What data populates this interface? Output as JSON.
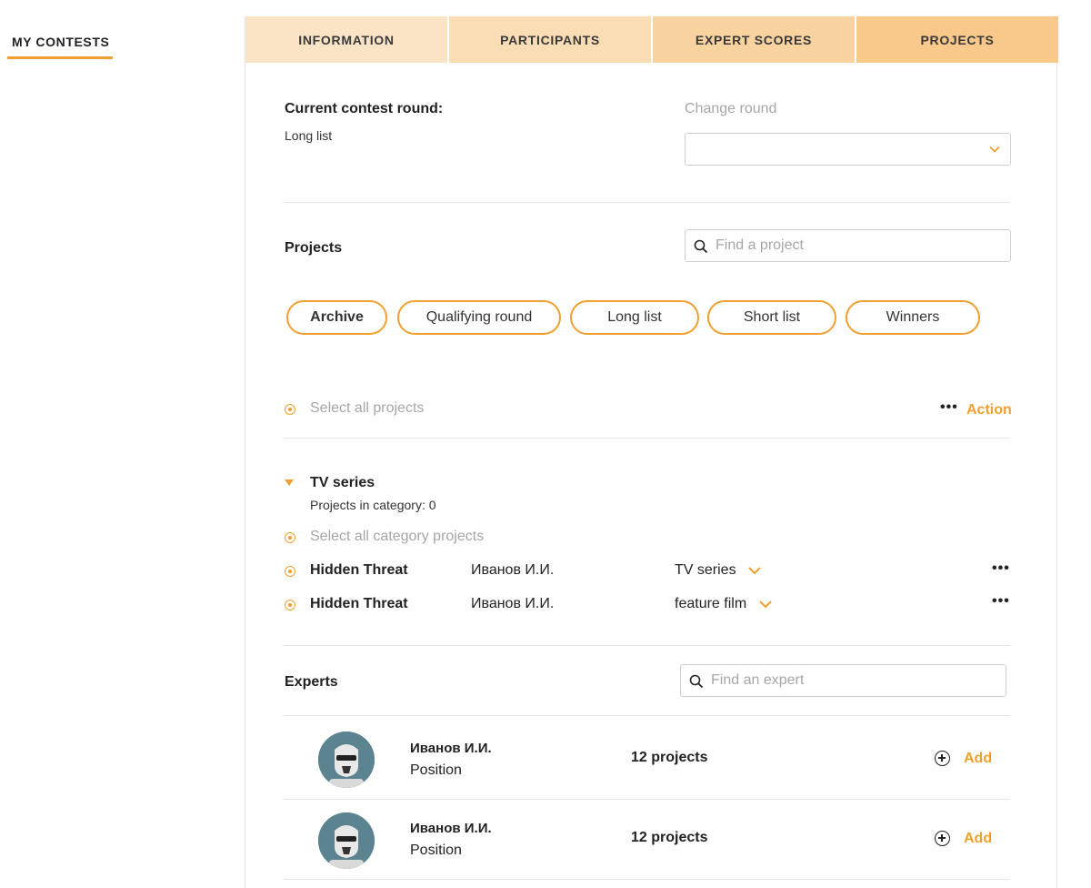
{
  "sidebar": {
    "my_contests": "MY CONTESTS"
  },
  "tabs": [
    {
      "label": "INFORMATION",
      "color": "#fbe4c6"
    },
    {
      "label": "PARTICIPANTS",
      "color": "#fadcb5"
    },
    {
      "label": "EXPERT SCORES",
      "color": "#f9d39f"
    },
    {
      "label": "PROJECTS",
      "color": "#f8c98a"
    }
  ],
  "round": {
    "current_label": "Current contest round:",
    "current_value": "Long list",
    "change_label": "Change round",
    "select_value": ""
  },
  "projects": {
    "title": "Projects",
    "search_placeholder": "Find a project",
    "filters": [
      "Archive",
      "Qualifying round",
      "Long list",
      "Short list",
      "Winners"
    ],
    "select_all": "Select all projects",
    "action_label": "Action",
    "category": {
      "name": "TV series",
      "count_text": "Projects in category: 0",
      "select_all": "Select all category projects",
      "items": [
        {
          "name": "Hidden Threat",
          "author": "Иванов И.И.",
          "type": "TV series"
        },
        {
          "name": "Hidden Threat",
          "author": "Иванов И.И.",
          "type": "feature film"
        }
      ]
    }
  },
  "experts": {
    "title": "Experts",
    "search_placeholder": "Find an expert",
    "add_label": "Add",
    "items": [
      {
        "name": "Иванов И.И.",
        "position": "Position",
        "projects": "12 projects"
      },
      {
        "name": "Иванов И.И.",
        "position": "Position",
        "projects": "12 projects"
      }
    ]
  },
  "colors": {
    "accent": "#f0a030"
  },
  "icons": {
    "search": "search-icon",
    "chevron": "chevron-down-icon",
    "more": "more-icon",
    "add": "add-circle-icon",
    "expand": "caret-down-icon"
  }
}
